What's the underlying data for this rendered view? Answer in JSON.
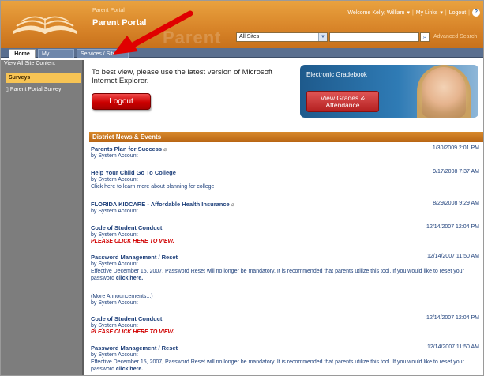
{
  "header": {
    "site_small": "Parent Portal",
    "site_title": "Parent Portal",
    "watermark": "Parent",
    "welcome": "Welcome Kelly, William",
    "my_links": "My Links",
    "logout_link": "Logout",
    "scope_value": "All Sites",
    "search_placeholder": "",
    "advanced_search": "Advanced Search"
  },
  "tabs": [
    {
      "label": "Home"
    },
    {
      "label": "My Child(ren)"
    },
    {
      "label": "Services / Sites"
    }
  ],
  "leftnav": {
    "view_all": "View All Site Content",
    "heading": "Surveys",
    "item": "Parent Portal Survey"
  },
  "main": {
    "notice": "To best view, please use the latest version of Microsoft Internet Explorer.",
    "logout_button": "Logout",
    "gradebook_title": "Electronic Gradebook",
    "gradebook_button": "View Grades & Attendance",
    "news_header": "District News & Events"
  },
  "news": [
    {
      "title": "Parents Plan for Success",
      "by": "by System Account",
      "date": "1/30/2009 2:01 PM"
    },
    {
      "title": "Help Your Child Go To College",
      "by": "by System Account",
      "body": "Click here to learn more about planning for college",
      "date": "9/17/2008 7:37 AM"
    },
    {
      "title": "FLORIDA KIDCARE - Affordable Health Insurance",
      "by": "by System Account",
      "date": "8/29/2008 9:29 AM"
    },
    {
      "title": "Code of Student Conduct",
      "by": "by System Account",
      "alert": "PLEASE CLICK HERE TO VIEW.",
      "date": "12/14/2007 12:04 PM"
    },
    {
      "title": "Password Management / Reset",
      "by": "by System Account",
      "body": "Effective December 15, 2007, Password Reset will no longer be mandatory.  It is recommended that parents utilize this tool.  If you would like to reset your password",
      "link": "click here.",
      "date": "12/14/2007 11:50 AM"
    }
  ],
  "more": {
    "label": "(More Announcements...)",
    "by": "by System Account"
  },
  "news2": [
    {
      "title": "Code of Student Conduct",
      "by": "by System Account",
      "alert": "PLEASE CLICK HERE TO VIEW.",
      "date": "12/14/2007 12:04 PM"
    },
    {
      "title": "Password Management / Reset",
      "by": "by System Account",
      "body": "Effective December 15, 2007, Password Reset will no longer be mandatory.  It is recommended that parents utilize this tool.  If you would like to reset your password",
      "link": "click here.",
      "date": "12/14/2007 11:50 AM"
    }
  ],
  "colors": {
    "header_orange": "#d9862a",
    "tab_blue": "#5a6f8f",
    "nav_gray": "#7d7d7d",
    "link_blue": "#1d3f7a",
    "alert_red": "#d00000",
    "arrow_red": "#e00000"
  },
  "icons": [
    "logo-book-icon",
    "dropdown-icon",
    "search-icon",
    "help-icon",
    "document-icon",
    "attachment-icon",
    "arrow-annotation"
  ]
}
